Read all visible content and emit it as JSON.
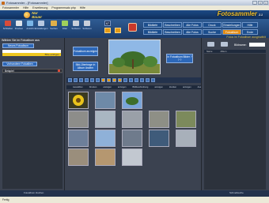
{
  "window": {
    "title": "Fotosammler - [Fotosammler]"
  },
  "menu": [
    "Fotosammler",
    "Hilfe",
    "Erweiterung",
    "Programmsatz.php",
    "Hilfe"
  ],
  "header": {
    "logo_text": "Nur Bauer",
    "app_title": "Fotosammler",
    "app_subtitle": "2.1"
  },
  "toolbar": {
    "buttons": [
      "Schließen",
      "Drucken",
      "Ansicht",
      "Einstellungen",
      "Suchen",
      "Filter",
      "Sortieren",
      "Sortieren",
      "Hilfe",
      "Beenden"
    ],
    "counter": "67",
    "tabs_row1": [
      "Bildtiefe",
      "Beschreiben",
      "Alle Fotos",
      "Druck",
      "Einstellungen",
      "Hilfe"
    ],
    "tabs_row2": [
      "Bildtiefe",
      "Beschreiben",
      "Alle Fotos",
      "Suche",
      "Fotoalbum",
      "Ende"
    ]
  },
  "left_panel": {
    "title": "Wählen Sie im Fotoalbum aus",
    "button_new": "Neues Fotoalbum",
    "input_value": "",
    "yellow_label": "Bitte einfügen",
    "button_edit": "Vorhandene Fotoalben",
    "selected_album": "Beispiel"
  },
  "center": {
    "btn_fotoalbum": "Fotoalbum anzeigen",
    "btn_bilder": "Bild-Übertrage in Album ändern",
    "btn_right": "In Fotoalbum Bilder ? ? ?",
    "columns": [
      "Auswählen",
      "Drucken",
      "anzeigen",
      "anzeigen",
      "Bildbeschreibung",
      "anzeigen",
      "drucken",
      "anzeigen",
      "Auswählen",
      "drehen"
    ]
  },
  "right_panel": {
    "title": "Fotos im Fotoalbum ausgewählt",
    "select_label": "Bildname: ",
    "columns": [
      "Name",
      "Album"
    ]
  },
  "bottom": {
    "left": "Fotoalbum löschen",
    "right": "Schnellsuche"
  },
  "status": "Fertig"
}
